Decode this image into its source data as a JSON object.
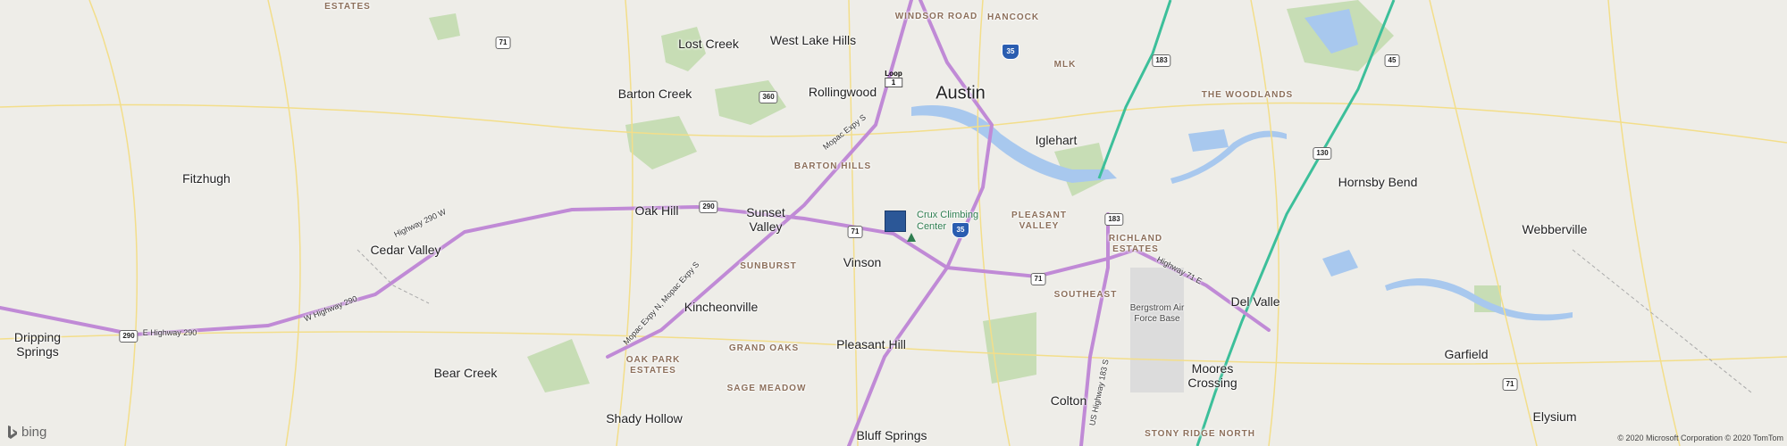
{
  "map": {
    "places": {
      "austin": "Austin",
      "lost_creek": "Lost Creek",
      "west_lake_hills": "West Lake Hills",
      "rollingwood": "Rollingwood",
      "barton_creek": "Barton Creek",
      "fitzhugh": "Fitzhugh",
      "oak_hill": "Oak Hill",
      "sunset_valley": "Sunset\nValley",
      "cedar_valley": "Cedar Valley",
      "dripping_springs": "Dripping\nSprings",
      "bear_creek": "Bear Creek",
      "shady_hollow": "Shady Hollow",
      "kincheonville": "Kincheonville",
      "vinson": "Vinson",
      "pleasant_hill": "Pleasant Hill",
      "bluff_springs": "Bluff Springs",
      "colton": "Colton",
      "iglehart": "Iglehart",
      "hornsby_bend": "Hornsby Bend",
      "webberville": "Webberville",
      "del_valle": "Del Valle",
      "garfield": "Garfield",
      "elysium": "Elysium",
      "moores_crossing": "Moores\nCrossing",
      "bergstrom": "Bergstrom Air\nForce Base"
    },
    "neighborhoods": {
      "windsor_road": "WINDSOR ROAD",
      "hancock": "HANCOCK",
      "mlk": "MLK",
      "the_woodlands": "THE WOODLANDS",
      "barton_hills": "BARTON HILLS",
      "pleasant_valley": "PLEASANT\nVALLEY",
      "richland_estates": "RICHLAND\nESTATES",
      "southeast": "SOUTHEAST",
      "sunburst": "SUNBURST",
      "grand_oaks": "GRAND OAKS",
      "oak_park_estates": "OAK PARK\nESTATES",
      "sage_meadow": "SAGE MEADOW",
      "stony_ridge_north": "STONY RIDGE NORTH",
      "creek_estates": "CREEK\nESTATES"
    },
    "poi": {
      "crux": "Crux Climbing\nCenter"
    },
    "roads": {
      "highway_290_w": "Highway 290 W",
      "w_highway_290": "W Highway 290",
      "e_highway_290": "E Highway 290",
      "mopac_expy_s": "Mopac Expy S",
      "mopac_expy_n_s": "Mopac Expy N, Mopac Expy S",
      "us_highway_183_s": "US Highway 183 S",
      "highway_71_e": "Highway 71 E",
      "loop": "Loop"
    },
    "shields": {
      "us71_a": "71",
      "us71_b": "71",
      "us71_c": "71",
      "us71_d": "71",
      "us290_a": "290",
      "us290_b": "290",
      "tx360": "360",
      "loop1": "1",
      "i35_a": "35",
      "i35_b": "35",
      "us183_a": "183",
      "us183_b": "183",
      "sh130": "130",
      "sh45": "45"
    }
  },
  "branding": {
    "logo": "bing",
    "copyright": "© 2020 Microsoft Corporation © 2020 TomTom"
  },
  "colors": {
    "land": "#eeede8",
    "park": "#c7ddb5",
    "water": "#a8c8ee",
    "highway": "#c08ad6",
    "arterial": "#f3de8a",
    "tollway": "#3cbf9a",
    "pin": "#2b5797"
  }
}
